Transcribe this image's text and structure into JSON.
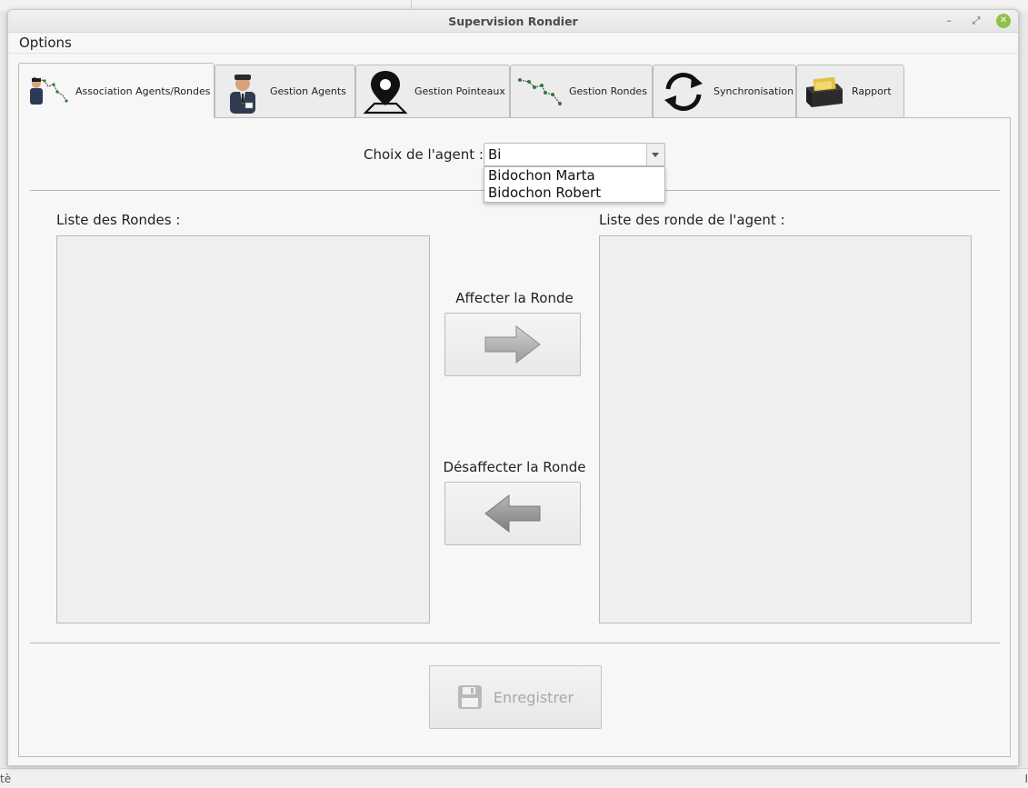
{
  "background": {
    "left_edge_text": "tè",
    "right_edge_text": "I"
  },
  "window": {
    "title": "Supervision Rondier",
    "controls": {
      "minimize": "–",
      "maximize": "⤢",
      "close": "✕"
    }
  },
  "menubar": {
    "options_label": "Options"
  },
  "tabs": [
    {
      "label": "Association Agents/Rondes",
      "icon": "agent-route-icon",
      "active": true
    },
    {
      "label": "Gestion Agents",
      "icon": "security-guard-icon",
      "active": false
    },
    {
      "label": "Gestion Pointeaux",
      "icon": "map-pin-icon",
      "active": false
    },
    {
      "label": "Gestion Rondes",
      "icon": "route-path-icon",
      "active": false
    },
    {
      "label": "Synchronisation",
      "icon": "sync-icon",
      "active": false
    },
    {
      "label": "Rapport",
      "icon": "card-box-icon",
      "active": false
    }
  ],
  "agent_choice": {
    "label": "Choix de l'agent :",
    "value": "Bi",
    "options": [
      "Bidochon Marta",
      "Bidochon Robert"
    ]
  },
  "lists": {
    "rondes_label": "Liste des Rondes :",
    "agent_rondes_label": "Liste des ronde de l'agent :"
  },
  "actions": {
    "assign_label": "Affecter la Ronde",
    "unassign_label": "Désaffecter la Ronde",
    "save_label": "Enregistrer"
  },
  "colors": {
    "close_button": "#8fc14a",
    "arrow_fill": "#a9a9a9",
    "disabled_text": "#a8a8a8"
  }
}
